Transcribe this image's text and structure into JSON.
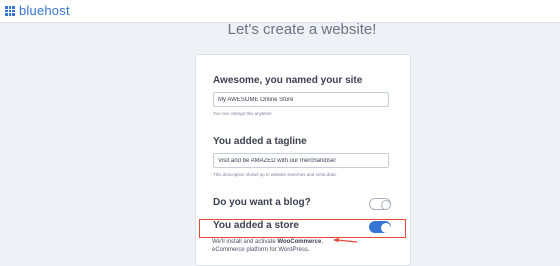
{
  "brand": {
    "name": "bluehost",
    "color": "#3575d3"
  },
  "page": {
    "title": "Let's create a website!"
  },
  "site_name": {
    "heading": "Awesome, you named your site",
    "value": "My AWESOME Online Store",
    "helper": "You can change this anytime!"
  },
  "tagline": {
    "heading": "You added a tagline",
    "value": "Visit and be AMAZED with our merchandise!",
    "helper": "This description shows up in website searches and meta data."
  },
  "blog": {
    "heading": "Do you want a blog?",
    "enabled": false
  },
  "store": {
    "heading": "You added a store",
    "enabled": true,
    "note_prefix": "We'll install and activate ",
    "note_product": "WooCommerce",
    "note_suffix": ",",
    "note_line2": "eCommerce platform for WordPress."
  },
  "colors": {
    "accent": "#3575d3",
    "annotation": "#e8473b"
  }
}
